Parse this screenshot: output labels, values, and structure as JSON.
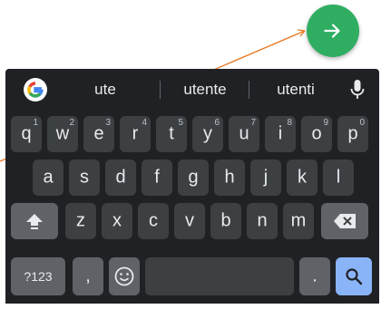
{
  "fab": {
    "icon": "arrow-right-icon",
    "color": "#2fae62"
  },
  "keyboard": {
    "theme": {
      "background": "#202124",
      "key": "#3c4043",
      "function_key": "#5f6368",
      "search_key": "#8ab4f8"
    },
    "suggestions": [
      "ute",
      "utente",
      "utenti"
    ],
    "row1": [
      {
        "k": "q",
        "n": "1"
      },
      {
        "k": "w",
        "n": "2"
      },
      {
        "k": "e",
        "n": "3"
      },
      {
        "k": "r",
        "n": "4"
      },
      {
        "k": "t",
        "n": "5"
      },
      {
        "k": "y",
        "n": "6"
      },
      {
        "k": "u",
        "n": "7"
      },
      {
        "k": "i",
        "n": "8"
      },
      {
        "k": "o",
        "n": "9"
      },
      {
        "k": "p",
        "n": "0"
      }
    ],
    "row2": [
      "a",
      "s",
      "d",
      "f",
      "g",
      "h",
      "j",
      "k",
      "l"
    ],
    "row3": [
      "z",
      "x",
      "c",
      "v",
      "b",
      "n",
      "m"
    ],
    "symbols_label": "?123",
    "comma_label": ",",
    "period_label": "."
  }
}
